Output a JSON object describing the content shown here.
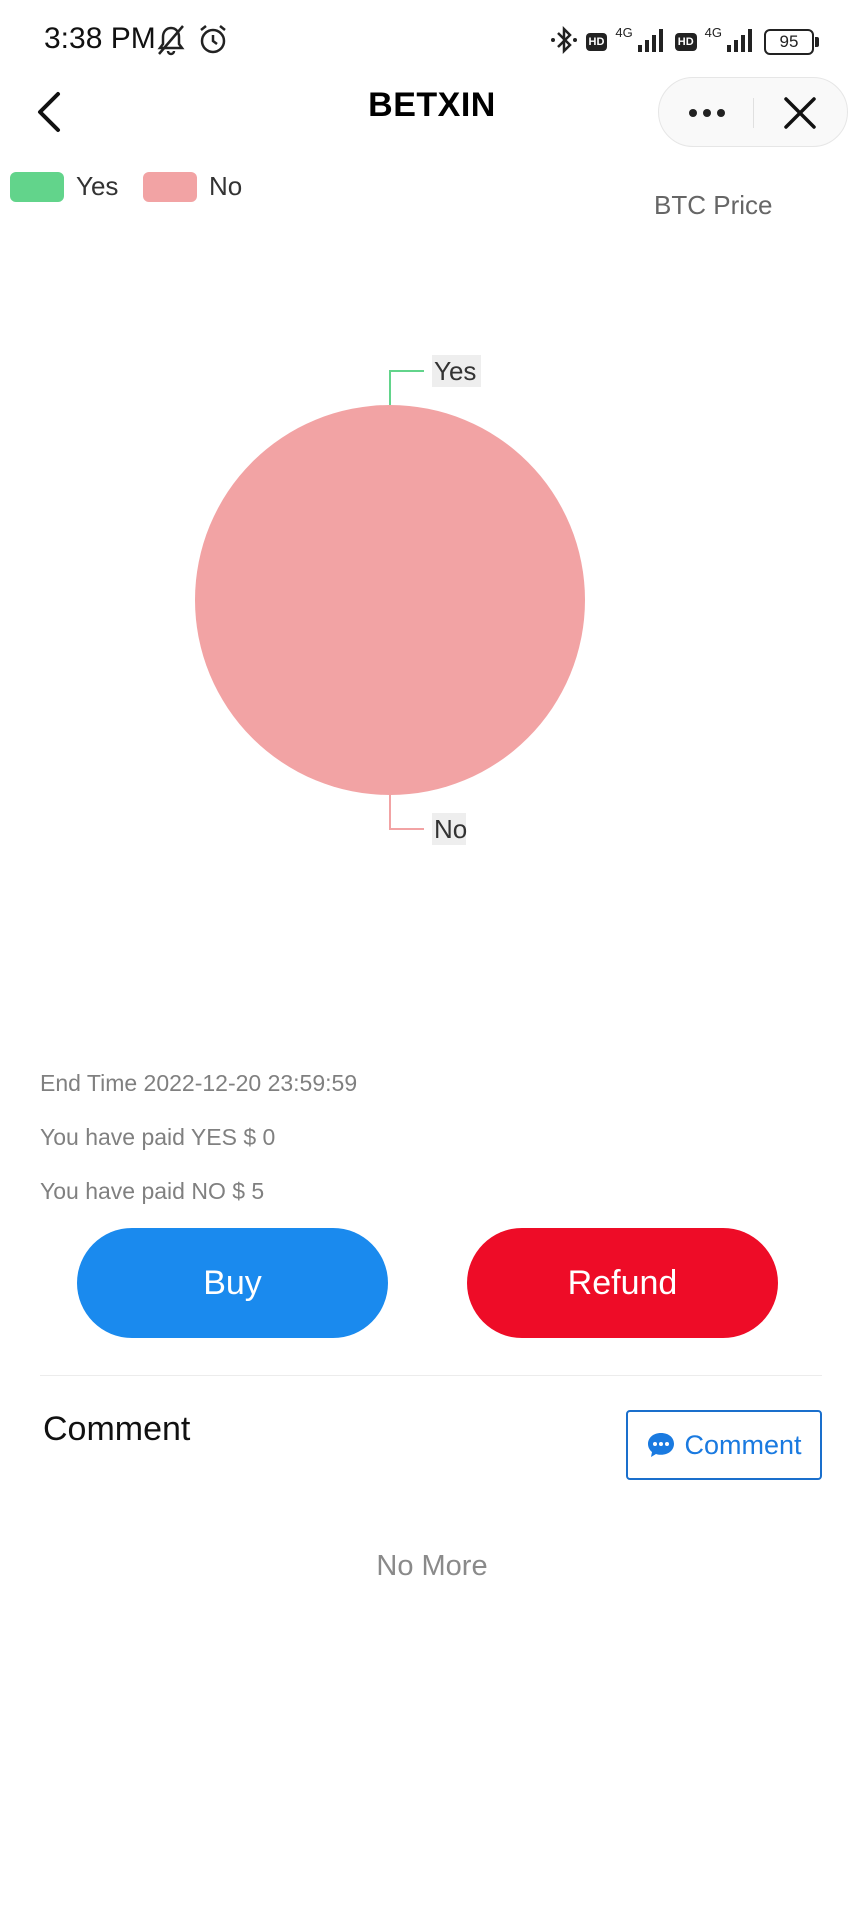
{
  "status_bar": {
    "time": "3:38 PM",
    "network_1": "4G",
    "network_2": "4G",
    "hd_1": "HD",
    "hd_2": "HD",
    "battery": "95"
  },
  "nav": {
    "title": "BETXIN",
    "back_icon": "chevron-left-icon",
    "more_icon": "more-dots-icon",
    "close_icon": "close-icon"
  },
  "legend": [
    {
      "label": "Yes",
      "color": "#62d48b"
    },
    {
      "label": "No",
      "color": "#f2a3a4"
    }
  ],
  "chart_caption": "BTC Price",
  "chart_data": {
    "type": "pie",
    "slices": [
      {
        "label": "Yes",
        "value": 0,
        "color": "#62d48b"
      },
      {
        "label": "No",
        "value": 5,
        "color": "#f2a3a4"
      }
    ]
  },
  "info": {
    "end_time": "End Time 2022-12-20 23:59:59",
    "paid_yes": "You have paid YES $ 0",
    "paid_no": "You have paid NO $ 5"
  },
  "actions": {
    "buy_label": "Buy",
    "refund_label": "Refund",
    "buy_color": "#1a8aee",
    "refund_color": "#ee0c27"
  },
  "comments": {
    "title": "Comment",
    "button_label": "Comment",
    "button_icon": "chat-bubble-icon",
    "empty_text": "No More"
  }
}
